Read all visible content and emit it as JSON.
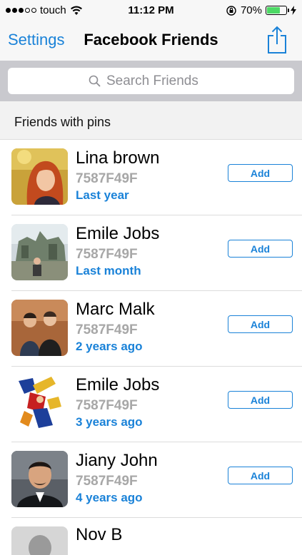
{
  "status_bar": {
    "carrier": "touch",
    "time": "11:12 PM",
    "battery_percent": "70%",
    "battery_level": 0.7,
    "signal_dots_filled": 3,
    "signal_dots_total": 5
  },
  "nav": {
    "back_label": "Settings",
    "title": "Facebook Friends",
    "share_icon": "share-icon"
  },
  "search": {
    "placeholder": "Search Friends",
    "icon": "search-icon"
  },
  "section": {
    "title": "Friends with pins"
  },
  "colors": {
    "accent": "#1a82d8",
    "code_gray": "#a7a7a7",
    "battery_green": "#4cd964"
  },
  "friends": [
    {
      "name": "Lina brown",
      "code": "7587F49F",
      "when": "Last year",
      "action": "Add"
    },
    {
      "name": "Emile Jobs",
      "code": "7587F49F",
      "when": "Last month",
      "action": "Add"
    },
    {
      "name": "Marc Malk",
      "code": "7587F49F",
      "when": "2 years ago",
      "action": "Add"
    },
    {
      "name": "Emile Jobs",
      "code": "7587F49F",
      "when": "3 years ago",
      "action": "Add"
    },
    {
      "name": "Jiany John",
      "code": "7587F49F",
      "when": "4 years ago",
      "action": "Add"
    },
    {
      "name": "Nov B"
    }
  ]
}
